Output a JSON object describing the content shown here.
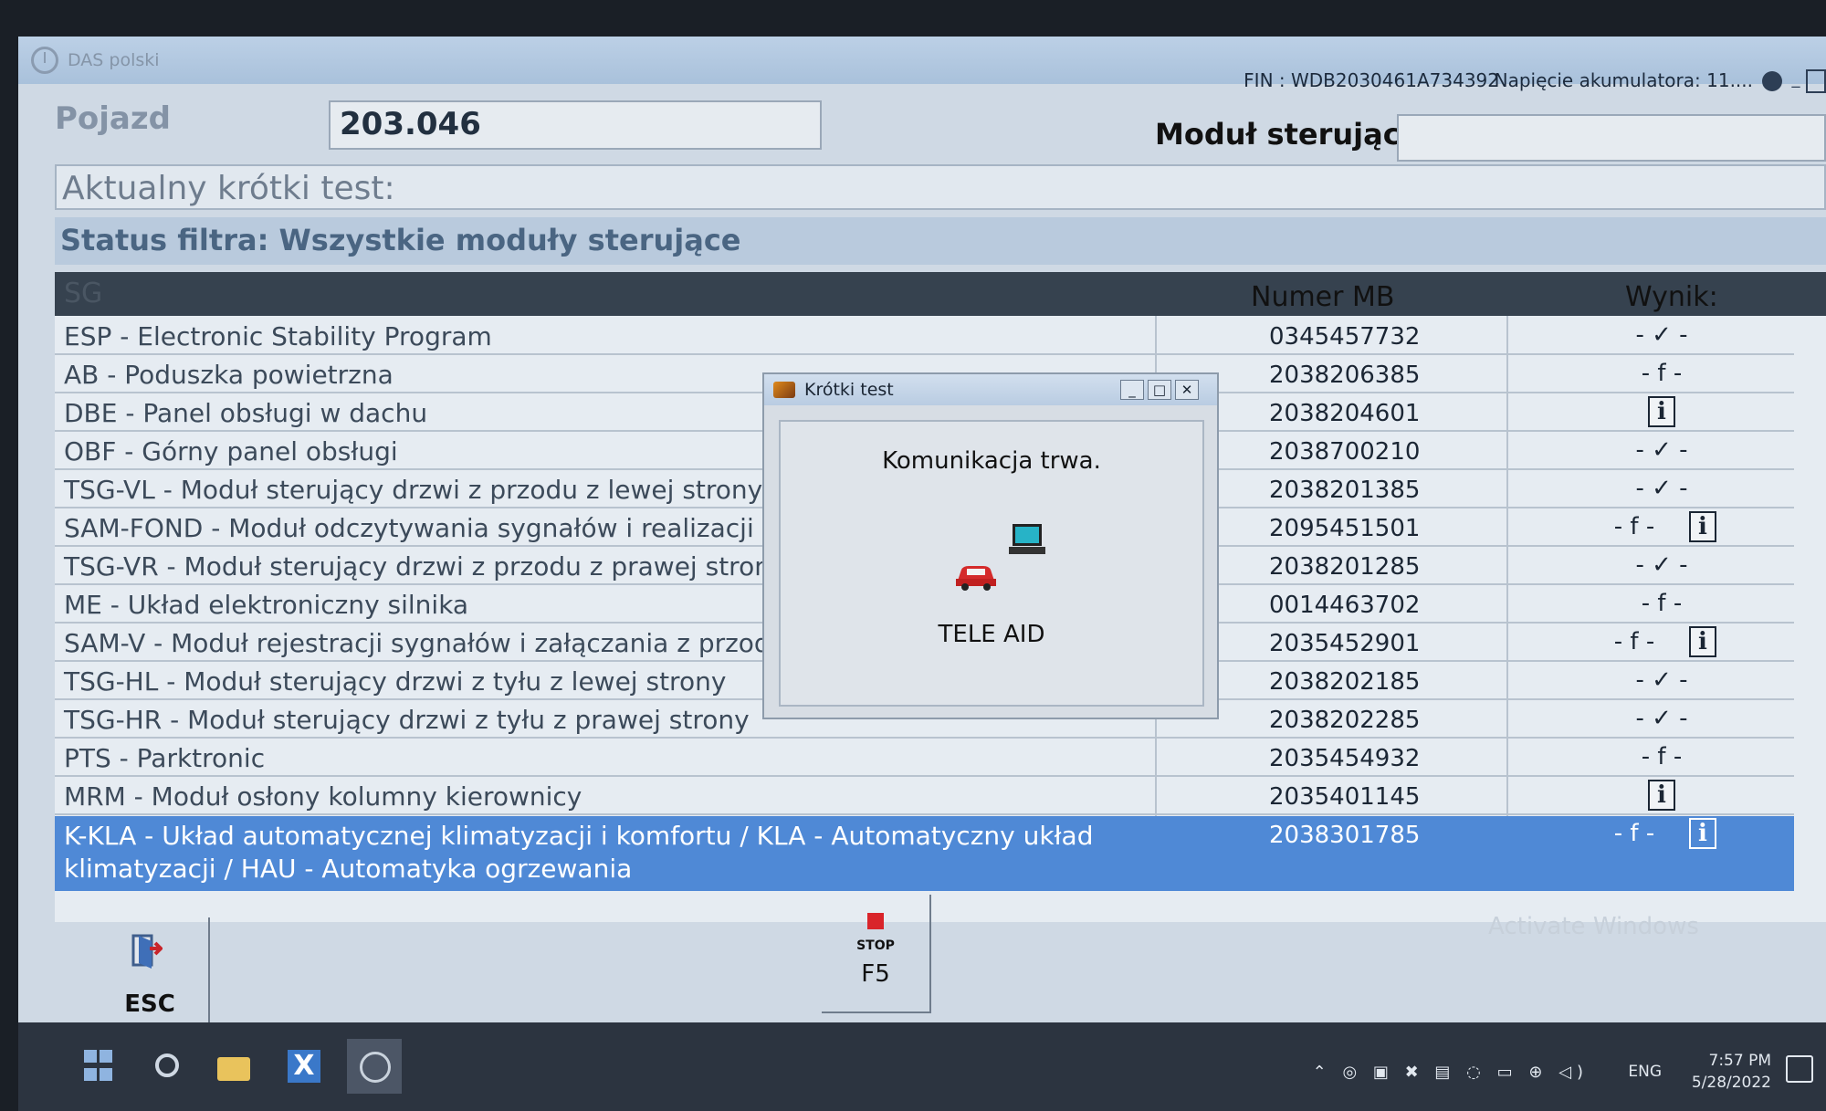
{
  "window": {
    "title": "DAS polski",
    "fin": "FIN : WDB2030461A734392",
    "voltage": "Napięcie akumulatora: 11...."
  },
  "vehicle": {
    "label": "Pojazd",
    "value": "203.046",
    "module_label": "Moduł sterujący",
    "module_value": ""
  },
  "current_test": "Aktualny krótki test:",
  "filter_status": "Status filtra: Wszystkie moduły sterujące",
  "table": {
    "headers": {
      "sg": "SG",
      "mb": "Numer MB",
      "result": "Wynik:"
    },
    "rows": [
      {
        "name": "ESP - Electronic Stability Program",
        "mb": "0345457732",
        "result": "- ✓ -",
        "info": false
      },
      {
        "name": "AB - Poduszka powietrzna",
        "mb": "2038206385",
        "result": "- f -",
        "info": false
      },
      {
        "name": "DBE - Panel obsługi w dachu",
        "mb": "2038204601",
        "result": "",
        "info": true
      },
      {
        "name": "OBF - Górny panel obsługi",
        "mb": "2038700210",
        "result": "- ✓ -",
        "info": false
      },
      {
        "name": "TSG-VL - Moduł sterujący drzwi z przodu z lewej strony",
        "mb": "2038201385",
        "result": "- ✓ -",
        "info": false
      },
      {
        "name": "SAM-FOND - Moduł odczytywania sygnałów i realizacji zas",
        "mb": "2095451501",
        "result": "- f -",
        "info": true
      },
      {
        "name": "TSG-VR - Moduł sterujący drzwi z przodu z prawej strony",
        "mb": "2038201285",
        "result": "- ✓ -",
        "info": false
      },
      {
        "name": "ME - Układ elektroniczny silnika",
        "mb": "0014463702",
        "result": "- f -",
        "info": false
      },
      {
        "name": "SAM-V - Moduł rejestracji sygnałów i załączania z przodu",
        "mb": "2035452901",
        "result": "- f -",
        "info": true
      },
      {
        "name": "TSG-HL - Moduł sterujący drzwi z tyłu z lewej strony",
        "mb": "2038202185",
        "result": "- ✓ -",
        "info": false
      },
      {
        "name": "TSG-HR - Moduł sterujący drzwi z tyłu z prawej strony",
        "mb": "2038202285",
        "result": "- ✓ -",
        "info": false
      },
      {
        "name": "PTS - Parktronic",
        "mb": "2035454932",
        "result": "- f -",
        "info": false
      },
      {
        "name": "MRM - Moduł osłony kolumny kierownicy",
        "mb": "2035401145",
        "result": "",
        "info": true
      },
      {
        "name": "K-KLA - Układ automatycznej klimatyzacji i komfortu / KLA - Automatyczny układ klimatyzacji / HAU - Automatyka ogrzewania",
        "mb": "2038301785",
        "result": "- f -",
        "info": true,
        "selected": true
      }
    ]
  },
  "dialog": {
    "title": "Krótki test",
    "message": "Komunikacja trwa.",
    "label": "TELE AID"
  },
  "buttons": {
    "esc": "ESC",
    "stop_text": "STOP",
    "stop_key": "F5"
  },
  "watermark": "Activate Windows",
  "taskbar": {
    "lang": "ENG",
    "time": "7:57 PM",
    "date": "5/28/2022"
  }
}
